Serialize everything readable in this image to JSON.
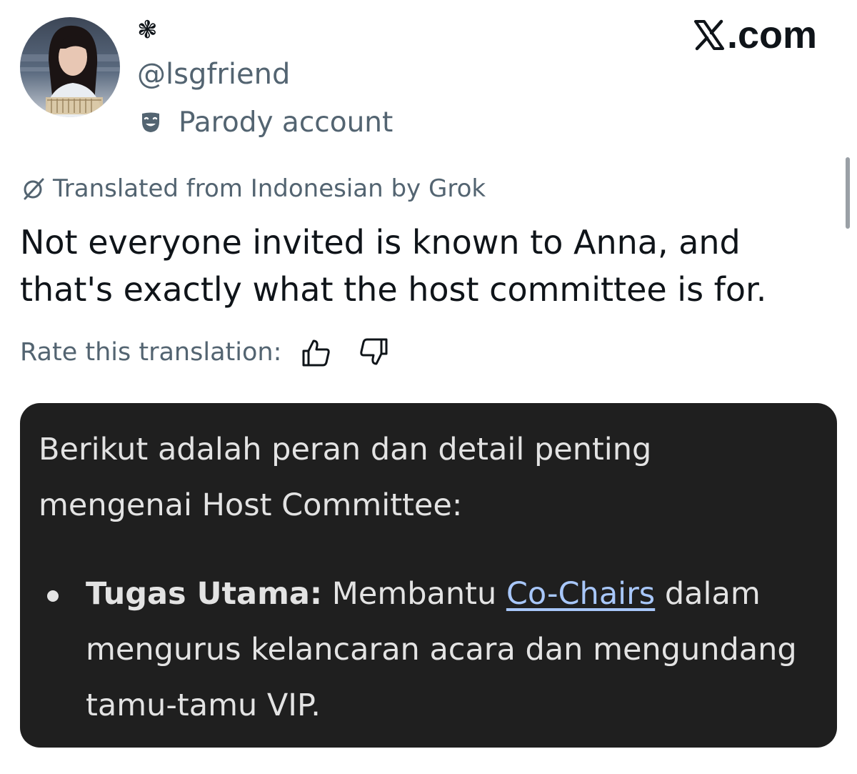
{
  "author": {
    "display_name": "❃",
    "handle": "@lsgfriend",
    "parody_label": "Parody account",
    "parody_icon": "theater-mask-icon"
  },
  "watermark": {
    "text": ".com",
    "logo": "x-logo-icon"
  },
  "translation": {
    "notice": "Translated from Indonesian by Grok",
    "icon": "grok-icon",
    "text": "Not everyone invited is known to Anna, and that's exactly what the host committee is for.",
    "rate_label": "Rate this translation:",
    "thumbs_up_icon": "thumbs-up-icon",
    "thumbs_down_icon": "thumbs-down-icon"
  },
  "media_card": {
    "intro": "Berikut adalah peran dan detail penting mengenai Host Committee:",
    "bullet": {
      "strong": "Tugas Utama:",
      "before_link": " Membantu ",
      "link": "Co-Chairs",
      "after_link": " dalam mengurus kelancaran acara dan mengundang tamu-tamu VIP."
    }
  },
  "colors": {
    "text_primary": "#0f1419",
    "text_secondary": "#536471",
    "card_background": "#1f1f1f",
    "card_text": "#e3e3e3",
    "link": "#a8c7fa"
  }
}
